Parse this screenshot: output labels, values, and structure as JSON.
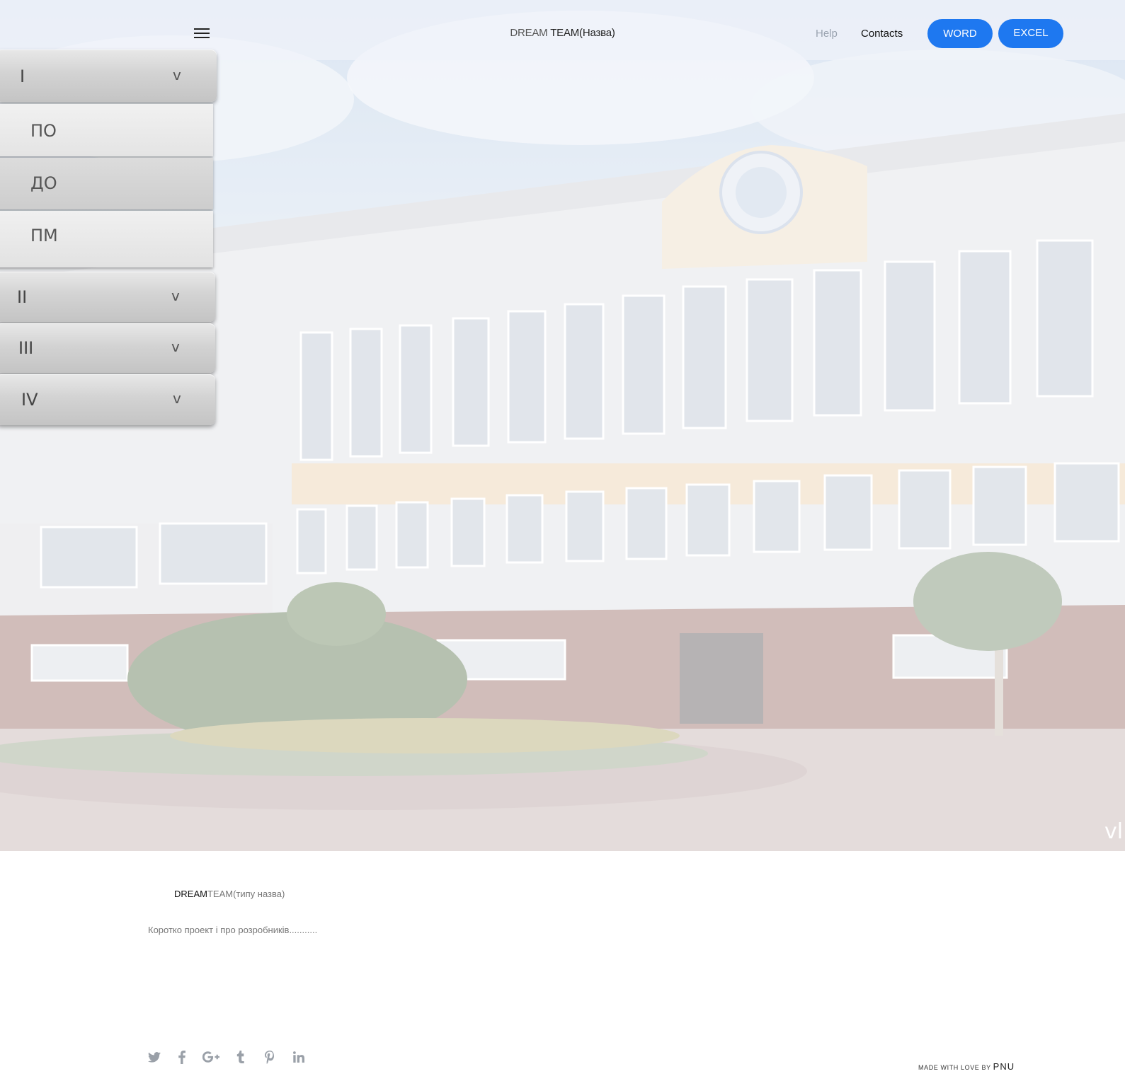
{
  "header": {
    "brand_part1": "DREAM ",
    "brand_part2": "TEAM(Назва)",
    "help_label": "Help",
    "contacts_label": "Contacts",
    "word_label": "WORD",
    "excel_label": "EXCEL"
  },
  "accordion": {
    "sections": [
      {
        "label": "I",
        "chevron": "v",
        "expanded": true,
        "items": [
          "ПО",
          "ДО",
          "ПМ"
        ]
      },
      {
        "label": "II",
        "chevron": "v",
        "expanded": false
      },
      {
        "label": "III",
        "chevron": "v",
        "expanded": false
      },
      {
        "label": "IV",
        "chevron": "v",
        "expanded": false
      }
    ]
  },
  "about": {
    "title_part1": "DREAM",
    "title_part2": "TEAM(типу назва)",
    "text": "Коротко проект і про розробників..........."
  },
  "social": [
    "twitter-icon",
    "facebook-icon",
    "google-plus-icon",
    "tumblr-icon",
    "pinterest-icon",
    "linkedin-icon"
  ],
  "footer": {
    "made_with": "MADE WITH LOVE BY",
    "brand": "PNU"
  },
  "hero": {
    "watermark": "vl"
  },
  "colors": {
    "accent": "#1e78f0",
    "social_icon": "#9aa0a8"
  }
}
